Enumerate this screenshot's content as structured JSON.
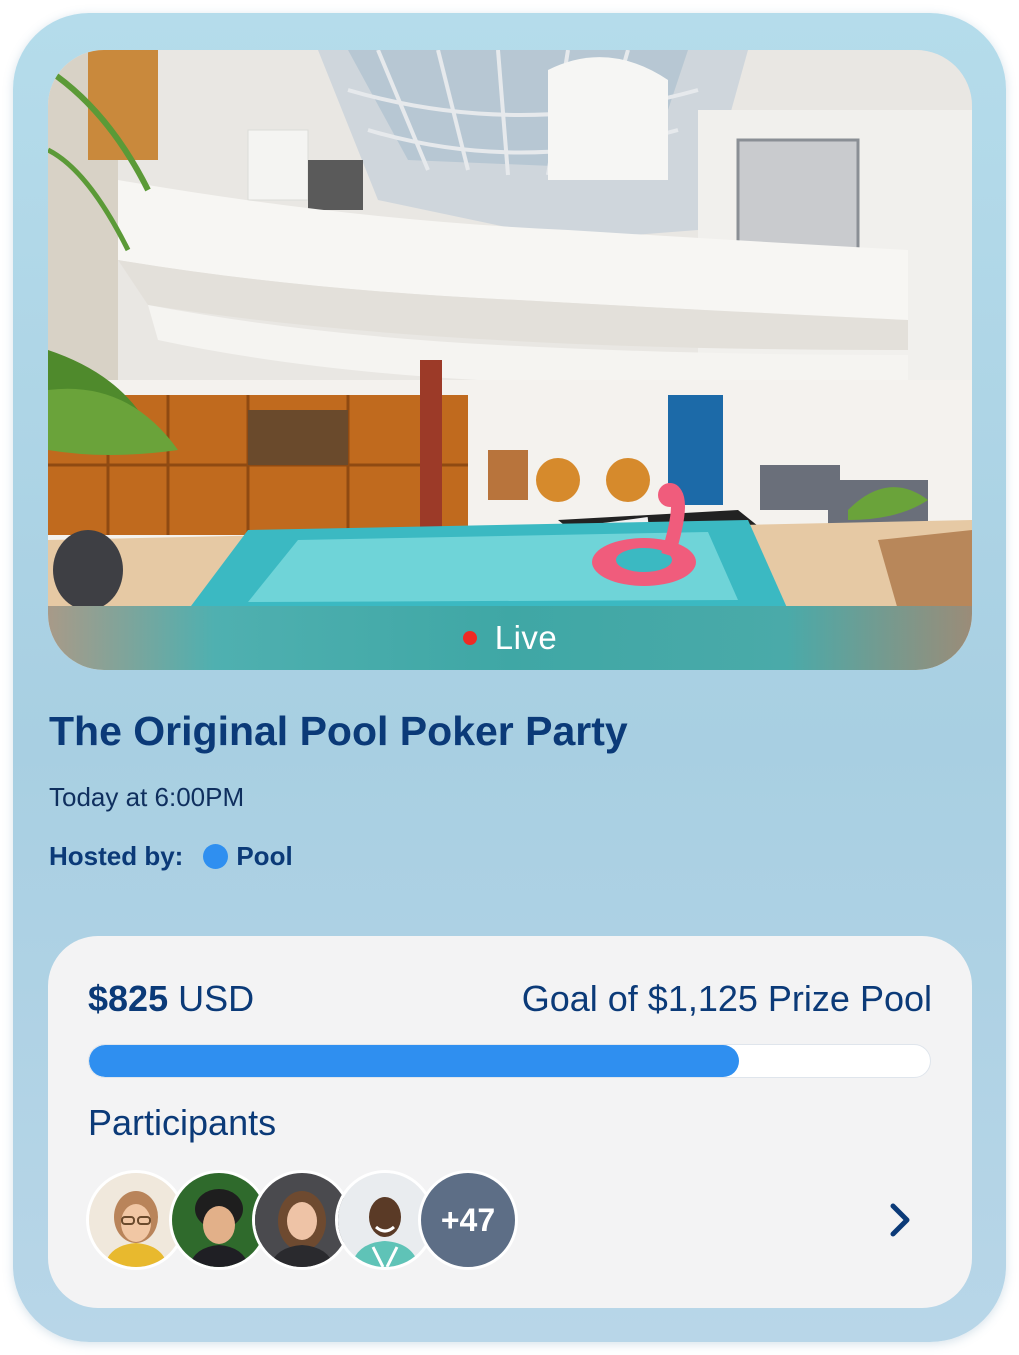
{
  "event": {
    "live_label": "Live",
    "title": "The Original Pool Poker Party",
    "time": "Today at 6:00PM",
    "host_label": "Hosted by:",
    "host_name": "Pool"
  },
  "funding": {
    "amount": "$825",
    "currency": "USD",
    "goal_text": "Goal of $1,125 Prize Pool",
    "progress_fraction": 0.773
  },
  "participants": {
    "label": "Participants",
    "extra_count": "+47",
    "avatars": [
      "avatar-1",
      "avatar-2",
      "avatar-3",
      "avatar-4"
    ]
  },
  "icons": {
    "live": "live-dot-icon",
    "host": "host-dot-icon",
    "next": "chevron-right-icon"
  },
  "colors": {
    "accent": "#2f8ff0",
    "live": "#ee2a24",
    "title": "#0b3a78"
  }
}
